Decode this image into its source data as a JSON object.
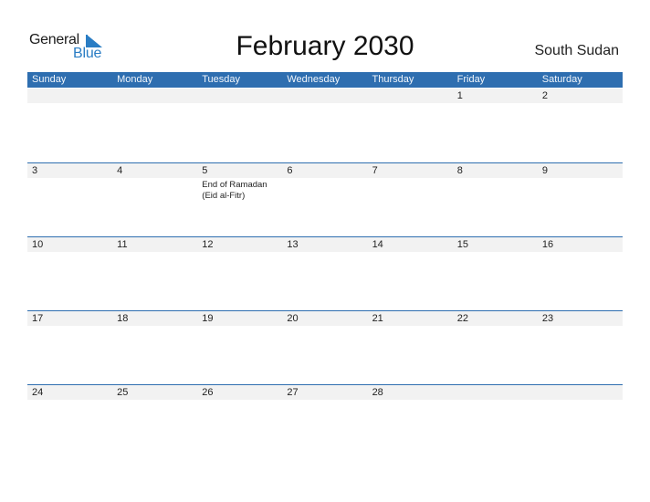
{
  "logo": {
    "general": "General",
    "blue": "Blue",
    "icon": "triangle-flag-icon",
    "accent_color": "#2a7dc4"
  },
  "title": "February 2030",
  "country": "South Sudan",
  "header_color": "#2e6eb0",
  "weekdays": [
    "Sunday",
    "Monday",
    "Tuesday",
    "Wednesday",
    "Thursday",
    "Friday",
    "Saturday"
  ],
  "weeks": [
    {
      "days": [
        "",
        "",
        "",
        "",
        "",
        "1",
        "2"
      ],
      "events": [
        "",
        "",
        "",
        "",
        "",
        "",
        ""
      ]
    },
    {
      "days": [
        "3",
        "4",
        "5",
        "6",
        "7",
        "8",
        "9"
      ],
      "events": [
        "",
        "",
        "End of Ramadan (Eid al-Fitr)",
        "",
        "",
        "",
        ""
      ]
    },
    {
      "days": [
        "10",
        "11",
        "12",
        "13",
        "14",
        "15",
        "16"
      ],
      "events": [
        "",
        "",
        "",
        "",
        "",
        "",
        ""
      ]
    },
    {
      "days": [
        "17",
        "18",
        "19",
        "20",
        "21",
        "22",
        "23"
      ],
      "events": [
        "",
        "",
        "",
        "",
        "",
        "",
        ""
      ]
    },
    {
      "days": [
        "24",
        "25",
        "26",
        "27",
        "28",
        "",
        ""
      ],
      "events": [
        "",
        "",
        "",
        "",
        "",
        "",
        ""
      ]
    }
  ]
}
